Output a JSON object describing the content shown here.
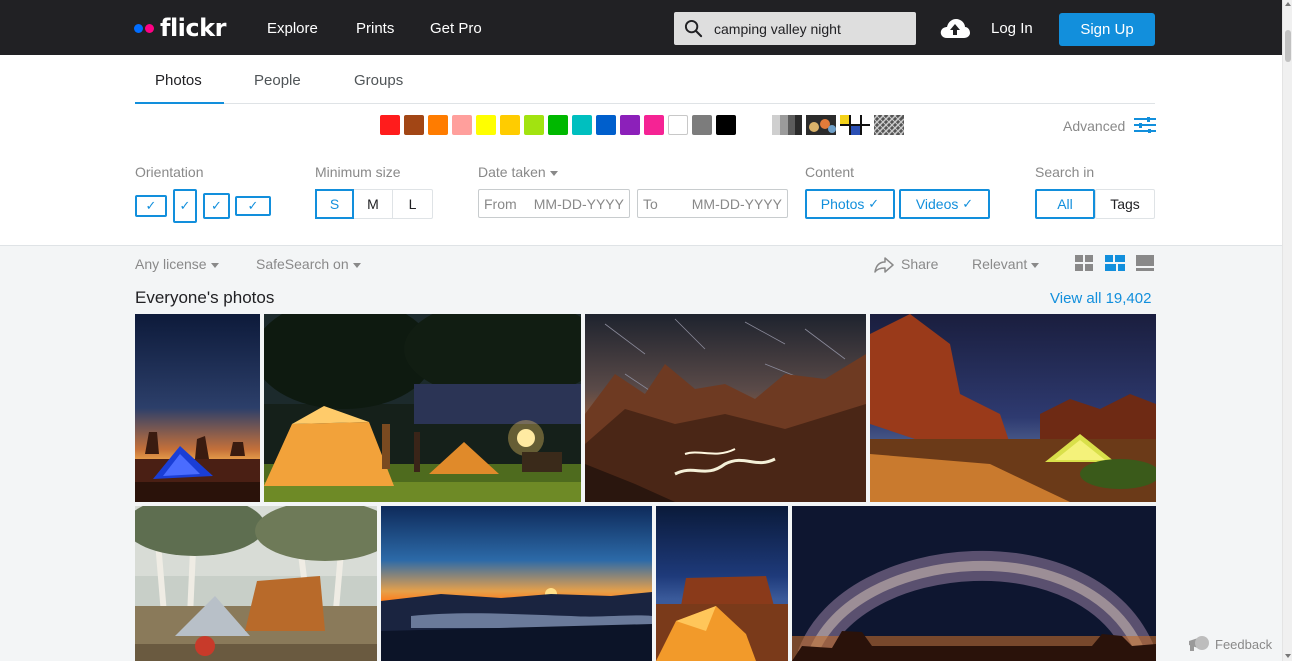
{
  "header": {
    "logo_text": "flickr",
    "nav": [
      "Explore",
      "Prints",
      "Get Pro"
    ],
    "search_value": "camping valley night",
    "login": "Log In",
    "signup": "Sign Up",
    "colors": {
      "bar": "#212124",
      "accent": "#128fdc",
      "logo_blue": "#006dff",
      "logo_pink": "#ff0084"
    }
  },
  "tabs": [
    "Photos",
    "People",
    "Groups"
  ],
  "color_swatches": [
    "#ff1c1c",
    "#a24615",
    "#ff7c00",
    "#ff9f9c",
    "#ffff00",
    "#ffcc00",
    "#a2e310",
    "#00b800",
    "#00bfbf",
    "#005fcc",
    "#8c20ba",
    "#f52394",
    "#ffffff",
    "#7c7c7c",
    "#000000"
  ],
  "advanced_label": "Advanced",
  "filters": {
    "orientation_label": "Orientation",
    "min_size_label": "Minimum size",
    "sizes": [
      "S",
      "M",
      "L"
    ],
    "date_label": "Date taken",
    "date_from": "From",
    "date_to": "To",
    "date_placeholder": "MM-DD-YYYY",
    "content_label": "Content",
    "content_photos": "Photos",
    "content_videos": "Videos",
    "search_in_label": "Search in",
    "search_all": "All",
    "search_tags": "Tags"
  },
  "subbar": {
    "license": "Any license",
    "safesearch": "SafeSearch on",
    "share": "Share",
    "sort": "Relevant"
  },
  "results": {
    "title": "Everyone's photos",
    "view_all": "View all 19,402"
  },
  "feedback": "Feedback"
}
